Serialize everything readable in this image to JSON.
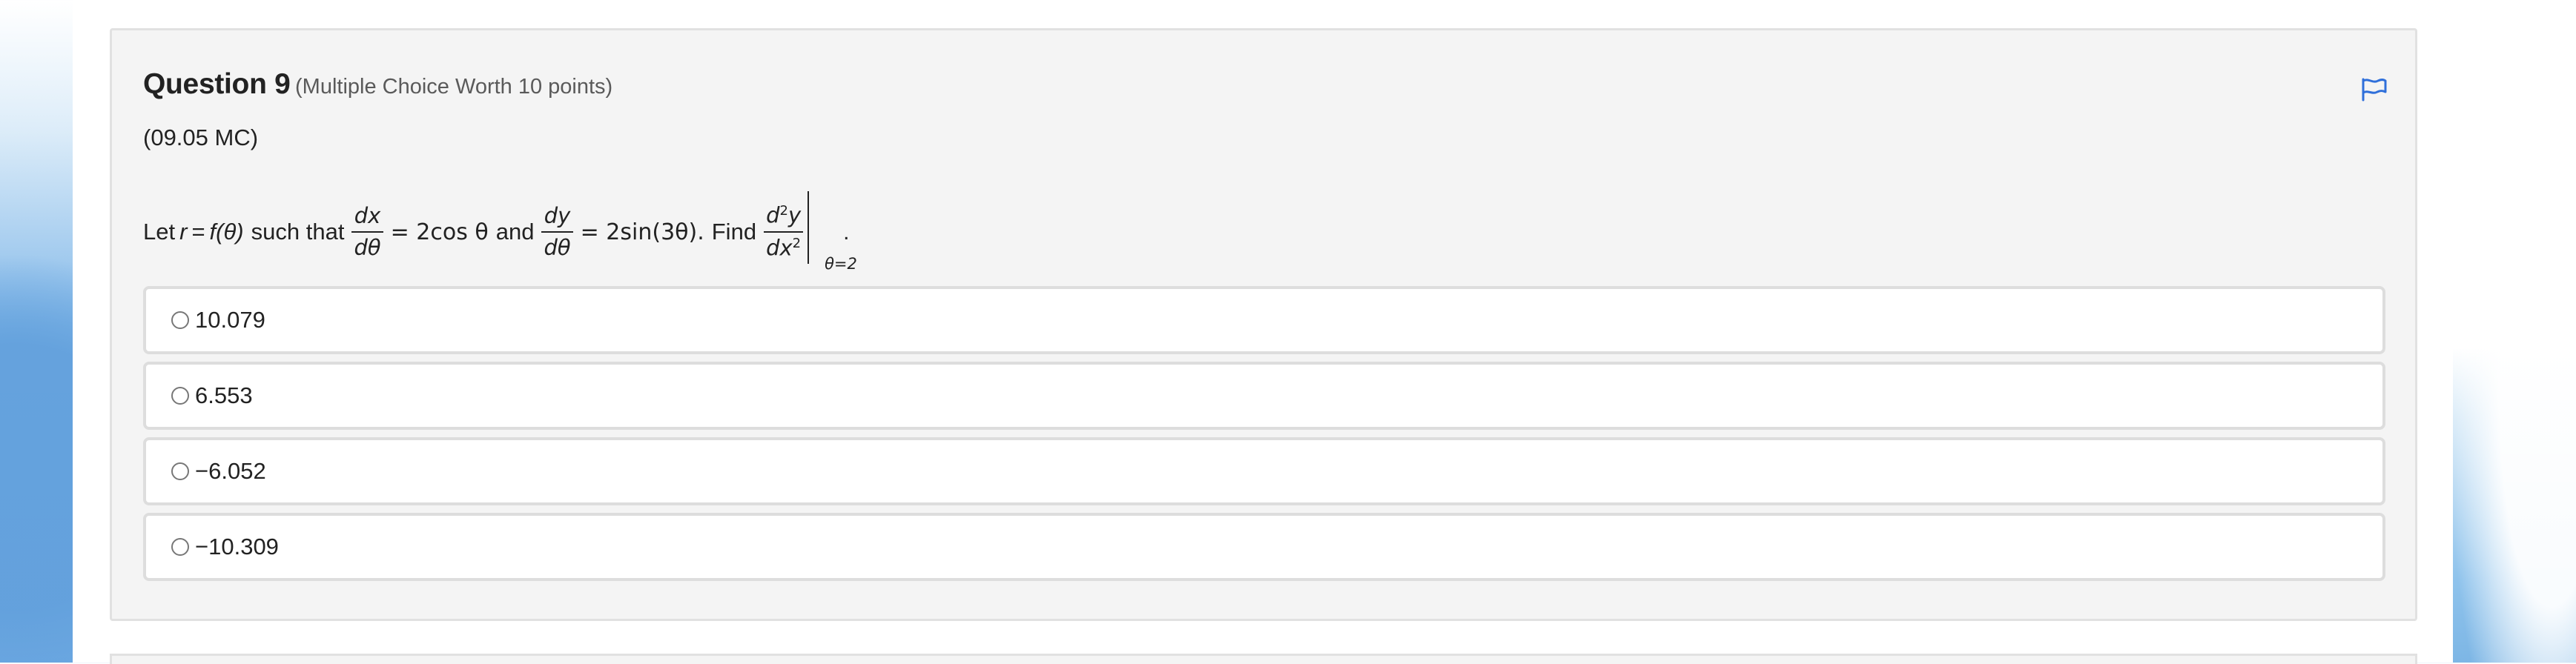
{
  "question": {
    "title": "Question 9",
    "meta": "(Multiple Choice Worth 10 points)",
    "code": "(09.05 MC)",
    "stem": {
      "let": "Let",
      "r": "r",
      "equals": "=",
      "f_theta": "f(θ)",
      "such_that": "such that",
      "dx": "dx",
      "dtheta": "dθ",
      "cos_expr": "= 2cos θ",
      "and": "and",
      "dy": "dy",
      "sin_expr": "= 2sin(3θ).",
      "find": "Find",
      "d2y_d": "d",
      "d2y_exp": "2",
      "d2y_y": "y",
      "dx2_dx": "dx",
      "dx2_exp": "2",
      "eval_at": "θ=2",
      "period": "."
    },
    "choices": [
      {
        "label": "10.079"
      },
      {
        "label": "6.553"
      },
      {
        "label": "−6.052"
      },
      {
        "label": "−10.309"
      }
    ]
  },
  "icons": {
    "flag": "flag-icon",
    "radio": "radio-icon"
  },
  "colors": {
    "accent": "#2f6fda",
    "card_background": "#f4f4f4",
    "text": "#222222"
  }
}
